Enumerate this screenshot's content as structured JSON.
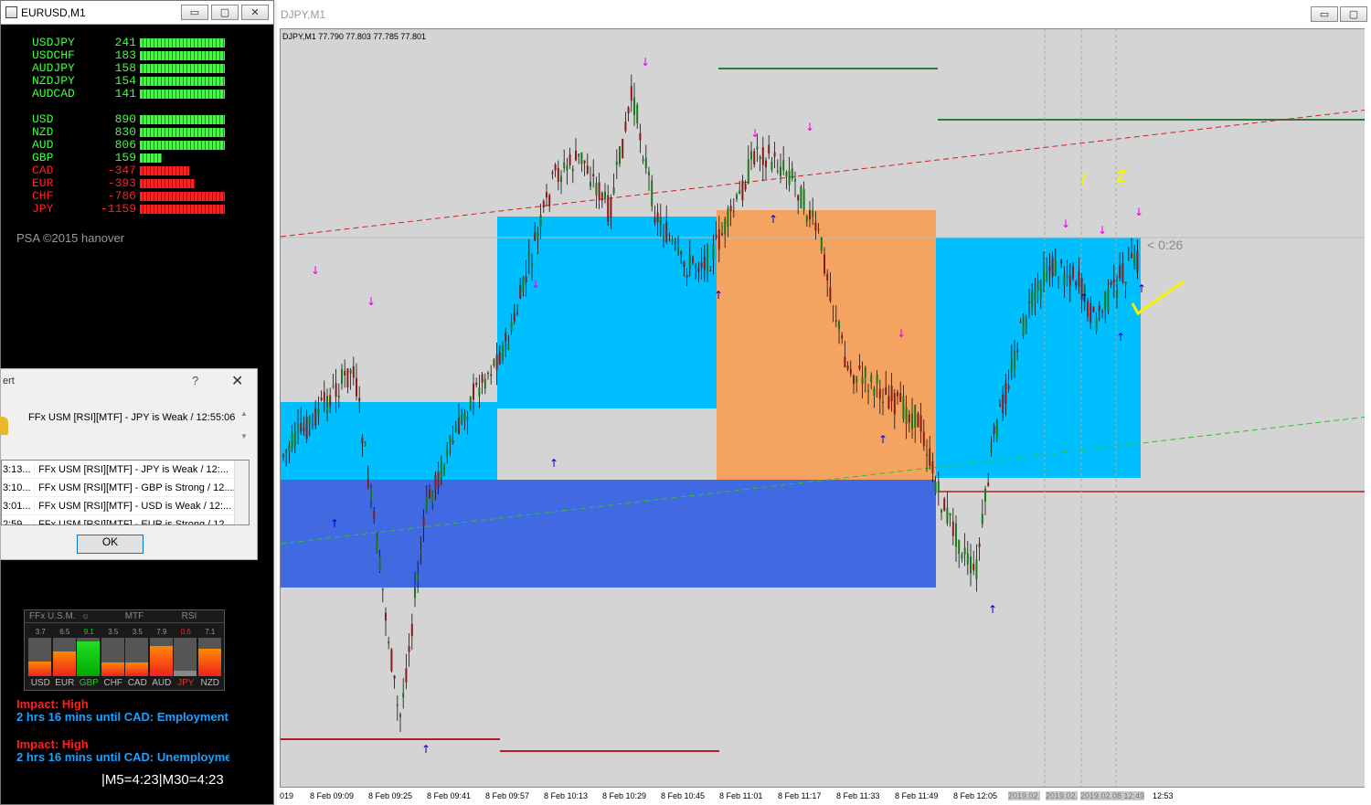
{
  "left_window": {
    "title": "EURUSD,M1",
    "buttons": {
      "minimize": "▭",
      "restore": "▢",
      "close": "✕"
    },
    "pairs": [
      {
        "name": "USDJPY",
        "value": "241",
        "color": "#3cff3c"
      },
      {
        "name": "USDCHF",
        "value": "183",
        "color": "#3cff3c"
      },
      {
        "name": "AUDJPY",
        "value": "158",
        "color": "#3cff3c"
      },
      {
        "name": "NZDJPY",
        "value": "154",
        "color": "#3cff3c"
      },
      {
        "name": "AUDCAD",
        "value": "141",
        "color": "#3cff3c"
      }
    ],
    "currencies": [
      {
        "name": "USD",
        "value": "890",
        "color": "#3cff3c",
        "level": 1.0
      },
      {
        "name": "NZD",
        "value": "830",
        "color": "#3cff3c",
        "level": 1.0
      },
      {
        "name": "AUD",
        "value": "806",
        "color": "#3cff3c",
        "level": 1.0
      },
      {
        "name": "GBP",
        "value": "159",
        "color": "#3cff3c",
        "level": 0.26
      },
      {
        "name": "CAD",
        "value": "-347",
        "color": "#ff2020",
        "level": 0.58
      },
      {
        "name": "EUR",
        "value": "-393",
        "color": "#ff2020",
        "level": 0.65
      },
      {
        "name": "CHF",
        "value": "-786",
        "color": "#ff2020",
        "level": 1.0
      },
      {
        "name": "JPY",
        "value": "-1159",
        "color": "#ff2020",
        "level": 1.0
      }
    ],
    "copyright": "PSA ©2015 hanover",
    "ffx_panel": {
      "headers": [
        "FFx U.S.M.",
        "MTF",
        "RSI"
      ],
      "values": [
        "3.7",
        "6.5",
        "9.1",
        "3.5",
        "3.5",
        "7.9",
        "0.6",
        "7.1"
      ],
      "levels": [
        0.37,
        0.65,
        0.91,
        0.35,
        0.35,
        0.79,
        0.06,
        0.71
      ],
      "names": [
        "USD",
        "EUR",
        "GBP",
        "CHF",
        "CAD",
        "AUD",
        "JPY",
        "NZD"
      ]
    },
    "news": [
      {
        "impact": "Impact: High",
        "text": "2 hrs 16 mins until CAD: Employment"
      },
      {
        "impact": "Impact: High",
        "text": "2 hrs 16 mins until CAD: Unemployme"
      }
    ],
    "timer": "|M5=4:23|M30=4:23"
  },
  "alert_dialog": {
    "title": "ert",
    "help": "?",
    "close": "✕",
    "message": "FFx USM [RSI][MTF] - JPY is Weak / 12:55:06",
    "rows": [
      {
        "time": "3:13...",
        "text": "FFx USM [RSI][MTF] - JPY is Weak / 12:..."
      },
      {
        "time": "3:10...",
        "text": "FFx USM [RSI][MTF] - GBP is Strong / 12...."
      },
      {
        "time": "3:01...",
        "text": "FFx USM [RSI][MTF] - USD is Weak / 12:..."
      },
      {
        "time": "2:59...",
        "text": "FFx USM [RSI][MTF] - EUR is Strong / 12...."
      }
    ],
    "ok_label": "OK"
  },
  "chart_window": {
    "title": "DJPY,M1",
    "ohlc_text": "DJPY,M1  77.790 77.803 77.785 77.801",
    "countdown": "< 0:26",
    "time_labels": [
      "019",
      "8 Feb 09:09",
      "8 Feb 09:25",
      "8 Feb 09:41",
      "8 Feb 09:57",
      "8 Feb 10:13",
      "8 Feb 10:29",
      "8 Feb 10:45",
      "8 Feb 11:01",
      "8 Feb 11:17",
      "8 Feb 11:33",
      "8 Feb 11:49",
      "8 Feb 12:05",
      "2019.02.",
      "2019.02.",
      "2019.02.08 12:49",
      "12:53"
    ],
    "colors": {
      "cyan_zone": "#00bfff",
      "orange_zone": "#f4a460",
      "blue_zone": "#4169e1",
      "bull": "#1a7a1a",
      "bear": "#8b1a1a",
      "down_arrow": "#e800e8",
      "up_arrow": "#0000cc"
    }
  }
}
